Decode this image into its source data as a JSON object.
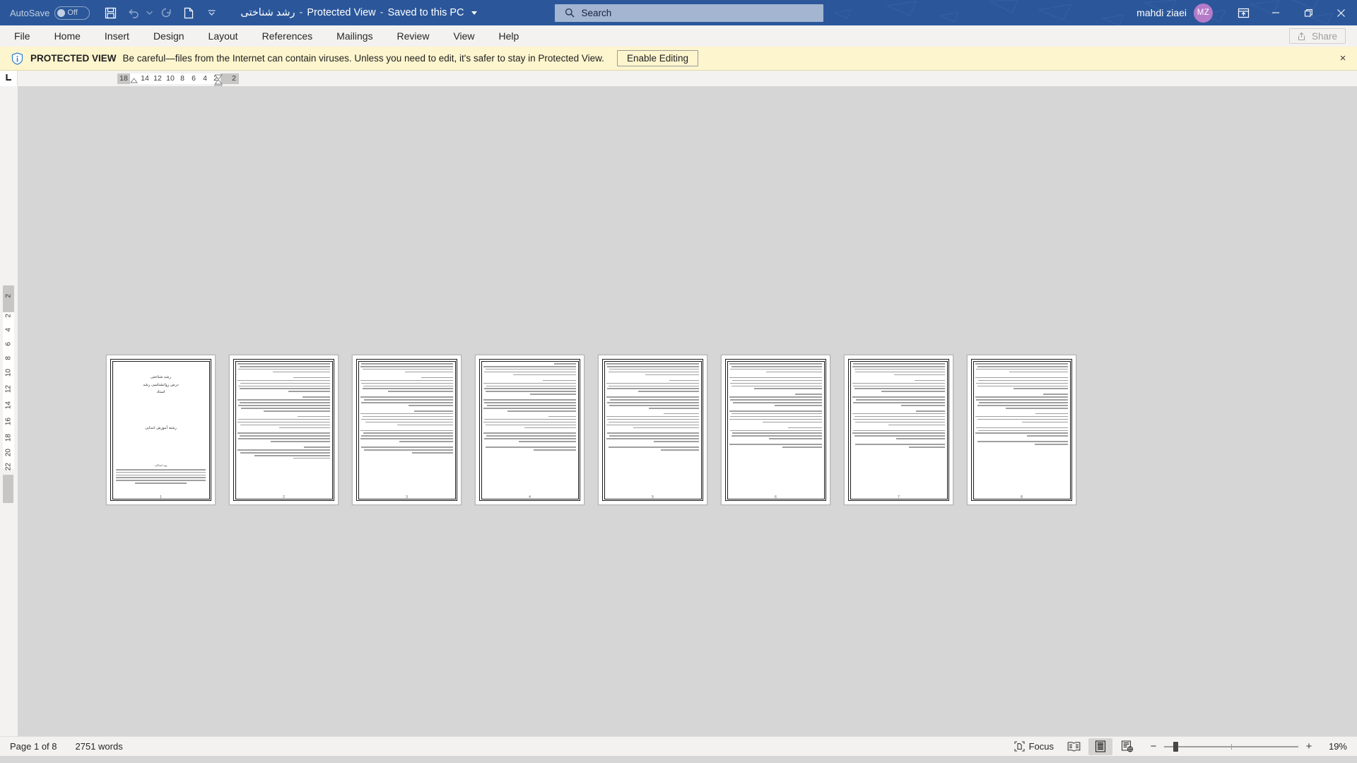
{
  "titlebar": {
    "autosave_label": "AutoSave",
    "autosave_state": "Off",
    "document_name": "رشد شناختی",
    "protected_view_tag": "Protected View",
    "save_location": "Saved to this PC",
    "search_placeholder": "Search",
    "user_name": "mahdi ziaei",
    "user_initials": "MZ",
    "accent_color": "#2b579a",
    "avatar_color": "#b57bc9",
    "qat": [
      {
        "name": "save-icon",
        "label": "Save"
      },
      {
        "name": "undo-icon",
        "label": "Undo"
      },
      {
        "name": "undo-dropdown-icon",
        "label": "Undo options"
      },
      {
        "name": "redo-icon",
        "label": "Redo"
      },
      {
        "name": "new-document-icon",
        "label": "New"
      },
      {
        "name": "customize-qat-icon",
        "label": "Customize Quick Access Toolbar"
      }
    ],
    "window_controls": [
      {
        "name": "ribbon-display-options-icon",
        "label": "Ribbon Display Options"
      },
      {
        "name": "minimize-icon",
        "label": "Minimize"
      },
      {
        "name": "restore-icon",
        "label": "Restore Down"
      },
      {
        "name": "close-icon",
        "label": "Close"
      }
    ]
  },
  "ribbon": {
    "tabs": [
      {
        "label": "File"
      },
      {
        "label": "Home"
      },
      {
        "label": "Insert"
      },
      {
        "label": "Design"
      },
      {
        "label": "Layout"
      },
      {
        "label": "References"
      },
      {
        "label": "Mailings"
      },
      {
        "label": "Review"
      },
      {
        "label": "View"
      },
      {
        "label": "Help"
      }
    ],
    "share_label": "Share",
    "share_enabled": false
  },
  "protected_view": {
    "title": "PROTECTED VIEW",
    "message": "Be careful—files from the Internet can contain viruses. Unless you need to edit, it's safer to stay in Protected View.",
    "button_label": "Enable Editing",
    "close_label": "×",
    "background_color": "#fdf5ce"
  },
  "ruler": {
    "horizontal_ticks": [
      "18",
      "14",
      "12",
      "10",
      "8",
      "6",
      "4",
      "2",
      "2"
    ],
    "vertical_ticks_grey": [
      "2"
    ],
    "vertical_ticks": [
      "2",
      "4",
      "6",
      "8",
      "10",
      "12",
      "14",
      "16",
      "18",
      "20",
      "22"
    ],
    "tab_stop_marker": "L"
  },
  "document": {
    "page_count": 8,
    "title_page": {
      "heading_lines": [
        "رشد شناختی",
        "درس روانشناسی رشد",
        "استاد"
      ],
      "subject_line": "رشته آموزش ابتدایی",
      "footer_lines": [
        "تهیه کنندگان:",
        "به منظور تکمیل درس روانشناسی رشد و با هدف بررسی مراحل رشد شناختی کودکان",
        "این پژوهش با استفاده از منابع معتبر علمی و نظریه‌های شناخته شده تدوین گردیده",
        "است و شامل بررسی نظریه پیاژه و ویگوتسکی در حوزه رشد شناختی می‌باشد."
      ]
    },
    "pages": [
      {
        "number": "1",
        "type": "title"
      },
      {
        "number": "2",
        "type": "text"
      },
      {
        "number": "3",
        "type": "text"
      },
      {
        "number": "4",
        "type": "text"
      },
      {
        "number": "5",
        "type": "text"
      },
      {
        "number": "6",
        "type": "text"
      },
      {
        "number": "7",
        "type": "text"
      },
      {
        "number": "8",
        "type": "text"
      }
    ]
  },
  "statusbar": {
    "page_indicator": "Page 1 of 8",
    "word_count": "2751 words",
    "focus_label": "Focus",
    "views": [
      {
        "name": "read-mode-icon",
        "label": "Read Mode",
        "active": false
      },
      {
        "name": "print-layout-icon",
        "label": "Print Layout",
        "active": true
      },
      {
        "name": "web-layout-icon",
        "label": "Web Layout",
        "active": false
      }
    ],
    "zoom_out": "−",
    "zoom_in": "+",
    "zoom_level": "19%"
  }
}
